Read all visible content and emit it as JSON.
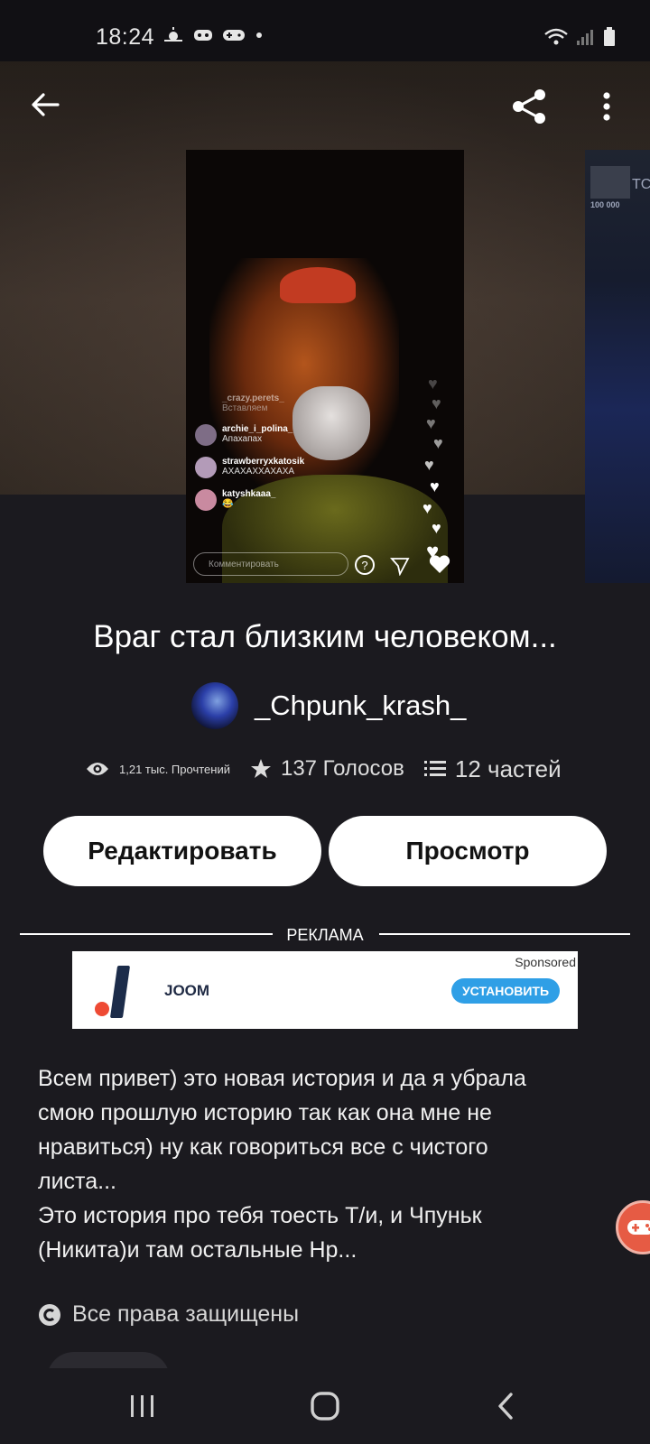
{
  "status_bar": {
    "time": "18:24"
  },
  "story": {
    "title": "Враг стал близким человеком...",
    "author": "_Chpunk_krash_",
    "stats": {
      "reads": "1,21 тыс. Прочтений",
      "votes": "137 Голосов",
      "parts": "12 частей"
    },
    "buttons": {
      "edit": "Редактировать",
      "view": "Просмотр"
    },
    "description_lines": [
      "Всем привет) это новая история и да я убрала",
      "смою прошлую историю так как она мне не",
      "нравиться) ну как говориться все с чистого",
      "листа...",
      "Это история про тебя тоесть Т/и, и Чпуньк",
      "(Никита)и там остальные Нр..."
    ],
    "copyright": "Все права защищены"
  },
  "cover": {
    "chat": [
      {
        "name": "_crazy.perets_",
        "text": "Вставляем"
      },
      {
        "name": "archie_i_polina_",
        "text": "Апахапах"
      },
      {
        "name": "strawberryxkatosik",
        "text": "АХАХАХХАХАХА"
      },
      {
        "name": "katyshkaaa_",
        "text": "😂"
      }
    ],
    "comment_placeholder": "Комментировать"
  },
  "next_cover": {
    "text": "TC",
    "count": "100 000"
  },
  "ad": {
    "label": "РЕКЛАМА",
    "sponsored": "Sponsored",
    "brand": "JOOM",
    "install": "УСТАНОВИТЬ"
  },
  "colors": {
    "background": "#1b1a1f",
    "button_bg": "#ffffff",
    "install_blue": "#2f9fe6",
    "fab_orange": "#e65b44"
  },
  "icons": [
    "back-arrow-icon",
    "share-icon",
    "more-vertical-icon",
    "eye-icon",
    "star-icon",
    "list-icon",
    "copyright-icon",
    "gamepad-icon",
    "recent-apps-icon",
    "home-icon",
    "nav-back-icon"
  ]
}
